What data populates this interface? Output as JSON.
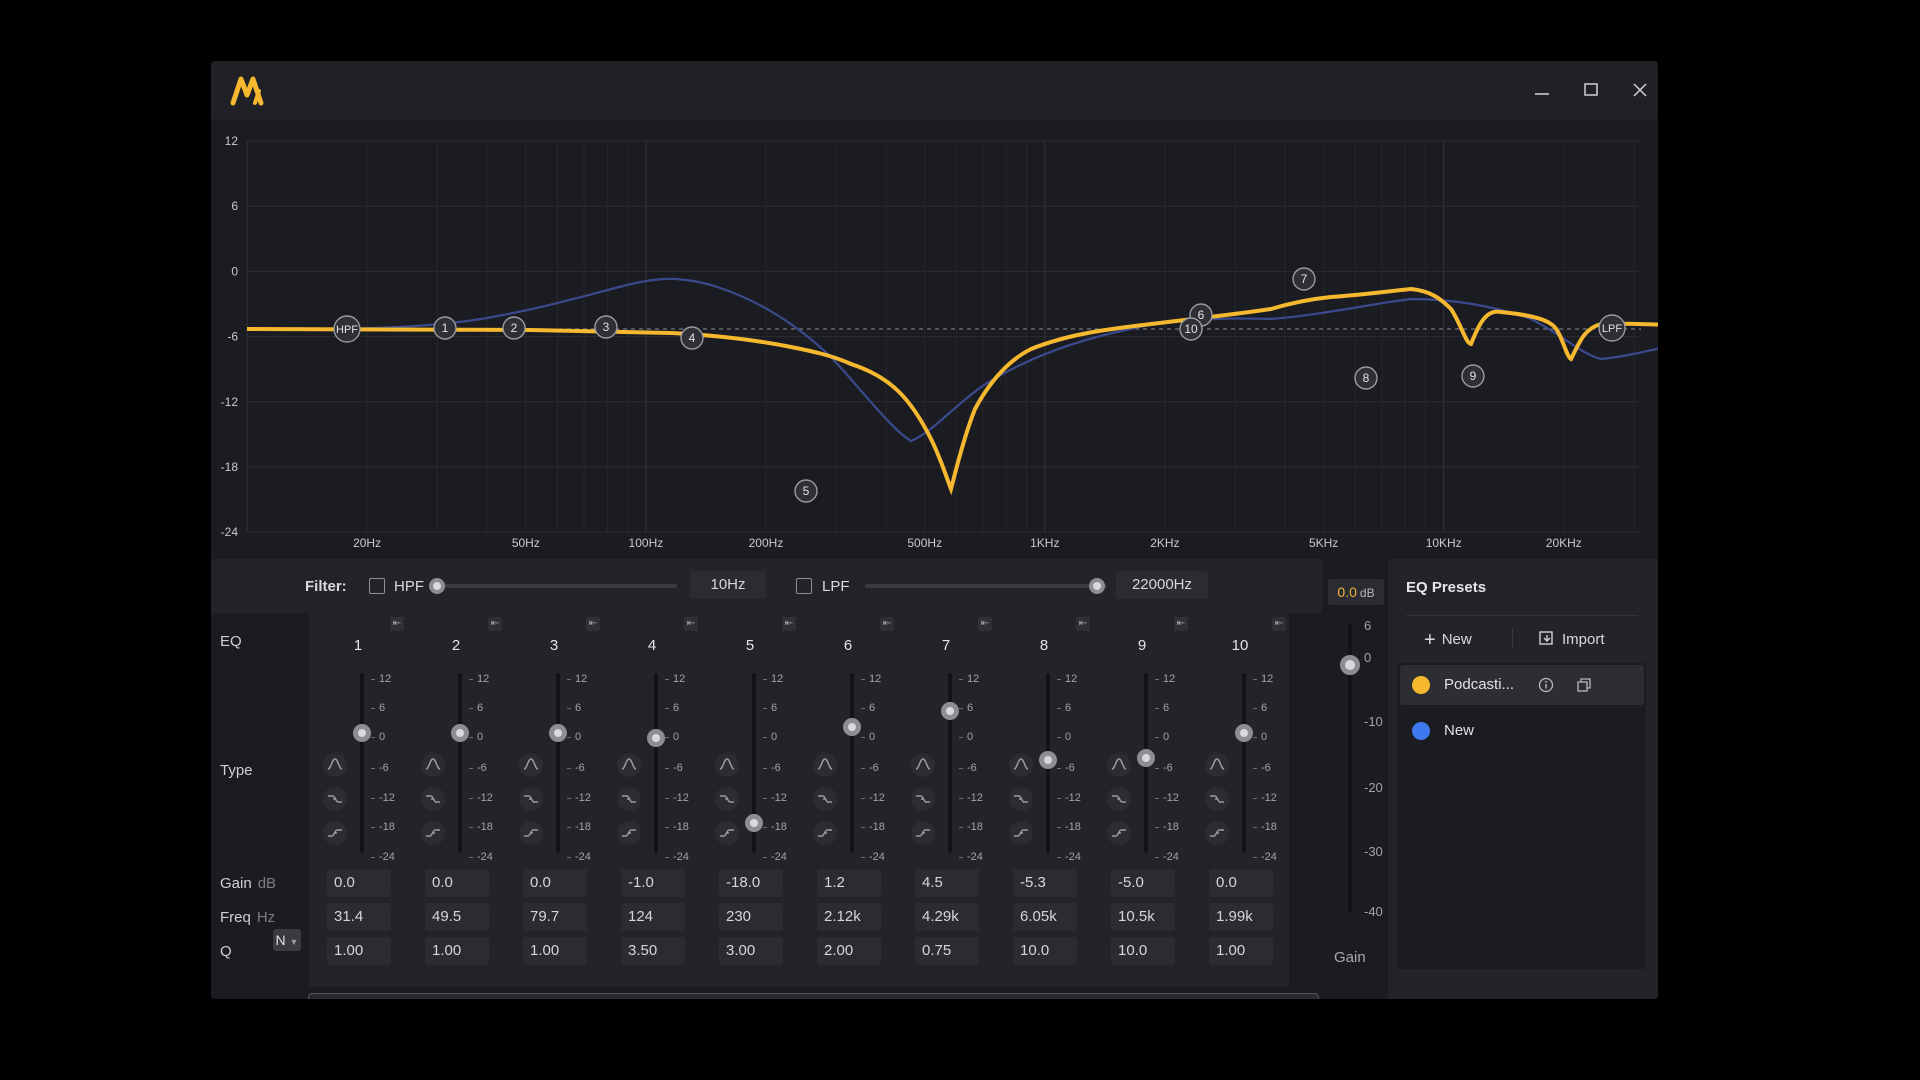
{
  "colors": {
    "accent": "#f5b82e",
    "reference_curve": "#3a4a8c",
    "preset_podcast": "#f5b82e",
    "preset_new": "#3d78ee"
  },
  "window": {
    "icons": [
      "app-logo",
      "minimize-icon",
      "maximize-icon",
      "close-icon"
    ]
  },
  "graph": {
    "y_ticks": [
      "12",
      "6",
      "0",
      "-6",
      "-12",
      "-18",
      "-24"
    ],
    "x_ticks": [
      "20Hz",
      "50Hz",
      "100Hz",
      "200Hz",
      "500Hz",
      "1KHz",
      "2KHz",
      "5KHz",
      "10KHz",
      "20KHz"
    ],
    "hpf_label": "HPF",
    "lpf_label": "LPF"
  },
  "filter": {
    "label": "Filter:",
    "hpf_label": "HPF",
    "hpf_value": "10Hz",
    "hpf_checked": false,
    "lpf_label": "LPF",
    "lpf_value": "22000Hz",
    "lpf_checked": false
  },
  "eq": {
    "row_labels": {
      "eq": "EQ",
      "type": "Type",
      "gain": "Gain",
      "gain_unit": "dB",
      "freq": "Freq",
      "freq_unit": "Hz",
      "q": "Q",
      "q_mode": "N"
    },
    "slider_ticks": [
      "12",
      "6",
      "0",
      "-6",
      "-12",
      "-18",
      "-24"
    ],
    "bands": [
      {
        "num": "1",
        "gain": "0.0",
        "freq": "31.4",
        "q": "1.00",
        "gain_value": 0.0
      },
      {
        "num": "2",
        "gain": "0.0",
        "freq": "49.5",
        "q": "1.00",
        "gain_value": 0.0
      },
      {
        "num": "3",
        "gain": "0.0",
        "freq": "79.7",
        "q": "1.00",
        "gain_value": 0.0
      },
      {
        "num": "4",
        "gain": "-1.0",
        "freq": "124",
        "q": "3.50",
        "gain_value": -1.0
      },
      {
        "num": "5",
        "gain": "-18.0",
        "freq": "230",
        "q": "3.00",
        "gain_value": -18.0
      },
      {
        "num": "6",
        "gain": "1.2",
        "freq": "2.12k",
        "q": "2.00",
        "gain_value": 1.2
      },
      {
        "num": "7",
        "gain": "4.5",
        "freq": "4.29k",
        "q": "0.75",
        "gain_value": 4.5
      },
      {
        "num": "8",
        "gain": "-5.3",
        "freq": "6.05k",
        "q": "10.0",
        "gain_value": -5.3
      },
      {
        "num": "9",
        "gain": "-5.0",
        "freq": "10.5k",
        "q": "10.0",
        "gain_value": -5.0
      },
      {
        "num": "10",
        "gain": "0.0",
        "freq": "1.99k",
        "q": "1.00",
        "gain_value": 0.0
      }
    ]
  },
  "master": {
    "value": "0.0",
    "unit": "dB",
    "ticks": [
      "6",
      "0",
      "-10",
      "-20",
      "-30",
      "-40"
    ],
    "label": "Gain"
  },
  "presets": {
    "title": "EQ Presets",
    "new_button": "New",
    "import_button": "Import",
    "items": [
      {
        "name": "Podcasti...",
        "selected": true
      },
      {
        "name": "New",
        "selected": false
      }
    ]
  }
}
